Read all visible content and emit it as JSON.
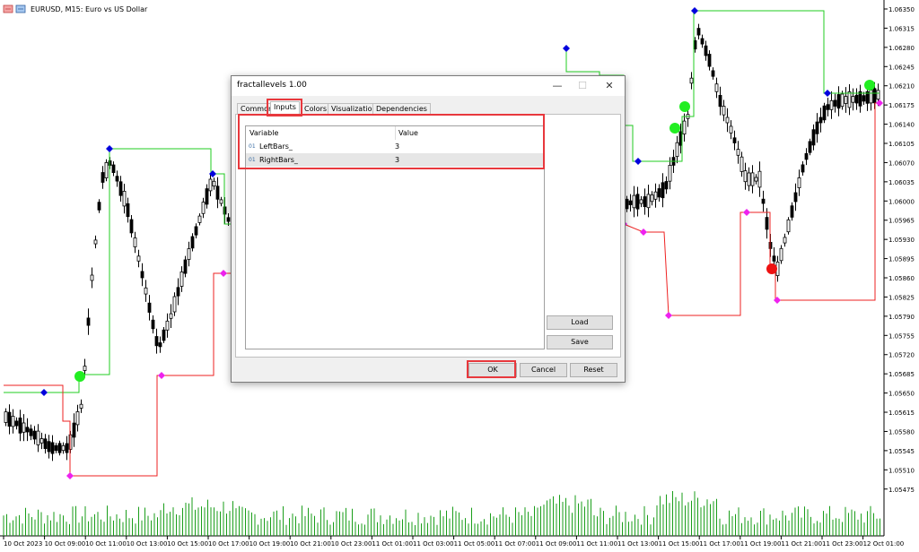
{
  "chart": {
    "title": "EURUSD, M15:  Euro vs US Dollar",
    "price_ticks": [
      "1.06350",
      "1.06315",
      "1.06280",
      "1.06245",
      "1.06210",
      "1.06175",
      "1.06140",
      "1.06105",
      "1.06070",
      "1.06035",
      "1.06000",
      "1.05965",
      "1.05930",
      "1.05895",
      "1.05860",
      "1.05825",
      "1.05790",
      "1.05755",
      "1.05720",
      "1.05685",
      "1.05650",
      "1.05615",
      "1.05580",
      "1.05545",
      "1.05510",
      "1.05475"
    ],
    "time_ticks": [
      "10 Oct 2023",
      "10 Oct 09:00",
      "10 Oct 11:00",
      "10 Oct 13:00",
      "10 Oct 15:00",
      "10 Oct 17:00",
      "10 Oct 19:00",
      "10 Oct 21:00",
      "10 Oct 23:00",
      "11 Oct 01:00",
      "11 Oct 03:00",
      "11 Oct 05:00",
      "11 Oct 07:00",
      "11 Oct 09:00",
      "11 Oct 11:00",
      "11 Oct 13:00",
      "11 Oct 15:00",
      "11 Oct 17:00",
      "11 Oct 19:00",
      "11 Oct 21:00",
      "11 Oct 23:00",
      "12 Oct 01:00"
    ],
    "colors": {
      "upper": "#22cc22",
      "lower": "#ee2222",
      "upper_marker": "#0000dd",
      "lower_marker": "#ee22ee",
      "signal_buy": "#22ee22",
      "signal_sell": "#ee1111",
      "volume": "#1a9e1a"
    }
  },
  "dialog": {
    "title": "fractallevels 1.00",
    "minimize": "—",
    "maximize": "☐",
    "close": "✕",
    "tabs": [
      "Common",
      "Inputs",
      "Colors",
      "Visualization",
      "Dependencies"
    ],
    "active_tab": "Inputs",
    "columns": {
      "variable": "Variable",
      "value": "Value"
    },
    "rows": [
      {
        "icon": "01",
        "variable": "LeftBars_",
        "value": "3"
      },
      {
        "icon": "01",
        "variable": "RightBars_",
        "value": "3"
      }
    ],
    "buttons": {
      "load": "Load",
      "save": "Save",
      "ok": "OK",
      "cancel": "Cancel",
      "reset": "Reset"
    }
  }
}
